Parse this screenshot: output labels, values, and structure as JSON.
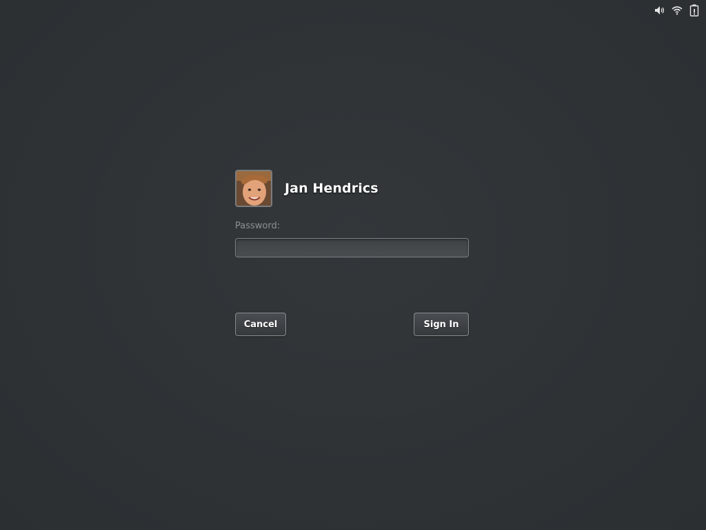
{
  "system_status": {
    "icons": [
      "volume-icon",
      "wifi-icon",
      "battery-icon"
    ]
  },
  "login": {
    "user": {
      "name": "Jan Hendrics",
      "avatar": "user-avatar-photo"
    },
    "password": {
      "label": "Password:",
      "value": "",
      "placeholder": ""
    },
    "buttons": {
      "cancel_label": "Cancel",
      "signin_label": "Sign In"
    }
  },
  "colors": {
    "background": "#2e3235",
    "input_border": "#7c8084",
    "label": "#8d9194",
    "text": "#ffffff"
  }
}
